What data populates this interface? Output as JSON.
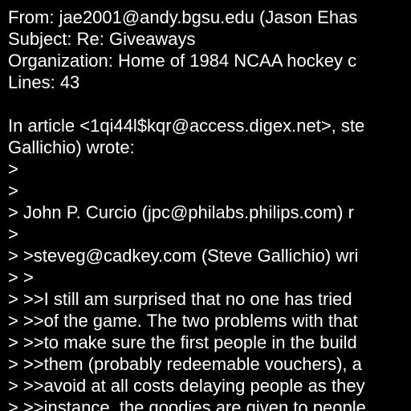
{
  "colors": {
    "background": "#000000",
    "text": "#ffffff"
  },
  "header": {
    "from": "From: jae2001@andy.bgsu.edu (Jason Ehas",
    "subject": "Subject: Re: Giveaways",
    "organization": "Organization: Home of 1984 NCAA hockey c",
    "lines": "Lines: 43"
  },
  "body": {
    "lines": [
      "",
      "In article <1qi44l$kqr@access.digex.net>, ste",
      "Gallichio) wrote:",
      ">",
      ">",
      "> John P. Curcio (jpc@philabs.philips.com) r",
      ">",
      "> >steveg@cadkey.com (Steve Gallichio) wri",
      "> >",
      "> >>I still am surprised that no one has tried",
      "> >>of the game. The two problems with that",
      "> >>to make sure the first people in the build",
      "> >>them (probably redeemable vouchers), a",
      "> >>avoid at all costs delaying people as they",
      "> >>instance, the goodies are given to people"
    ]
  }
}
